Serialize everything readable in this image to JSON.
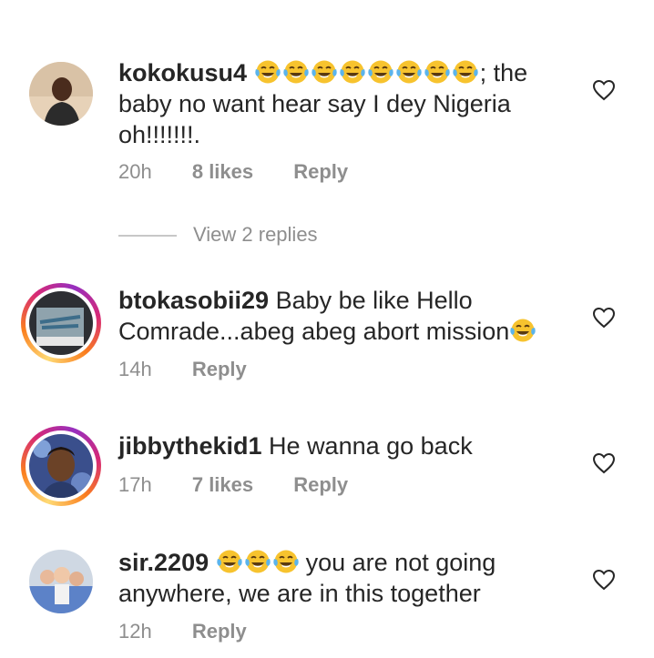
{
  "comments": [
    {
      "username": "kokokusu4",
      "emoji_count": 8,
      "text": "; the baby no want hear say I dey Nigeria oh!!!!!!!.",
      "time": "20h",
      "likes": "8 likes",
      "reply": "Reply",
      "has_story_ring": false
    },
    {
      "username": "btokasobii29",
      "text": "Baby be like Hello Comrade...abeg abeg abort mission",
      "time": "14h",
      "reply": "Reply",
      "has_story_ring": true
    },
    {
      "username": "jibbythekid1",
      "text": "He wanna go back",
      "time": "17h",
      "likes": "7 likes",
      "reply": "Reply",
      "has_story_ring": true
    },
    {
      "username": "sir.2209",
      "emoji_count": 3,
      "text": "you are not going anywhere, we are in this together",
      "time": "12h",
      "reply": "Reply",
      "has_story_ring": false
    }
  ],
  "view_replies": "View 2 replies",
  "icons": {
    "like": "heart-outline-icon",
    "emoji": "face-with-tears-of-joy-emoji"
  },
  "colors": {
    "text": "#262626",
    "secondary": "#8e8e8e",
    "emoji_face": "#f7c32e"
  }
}
